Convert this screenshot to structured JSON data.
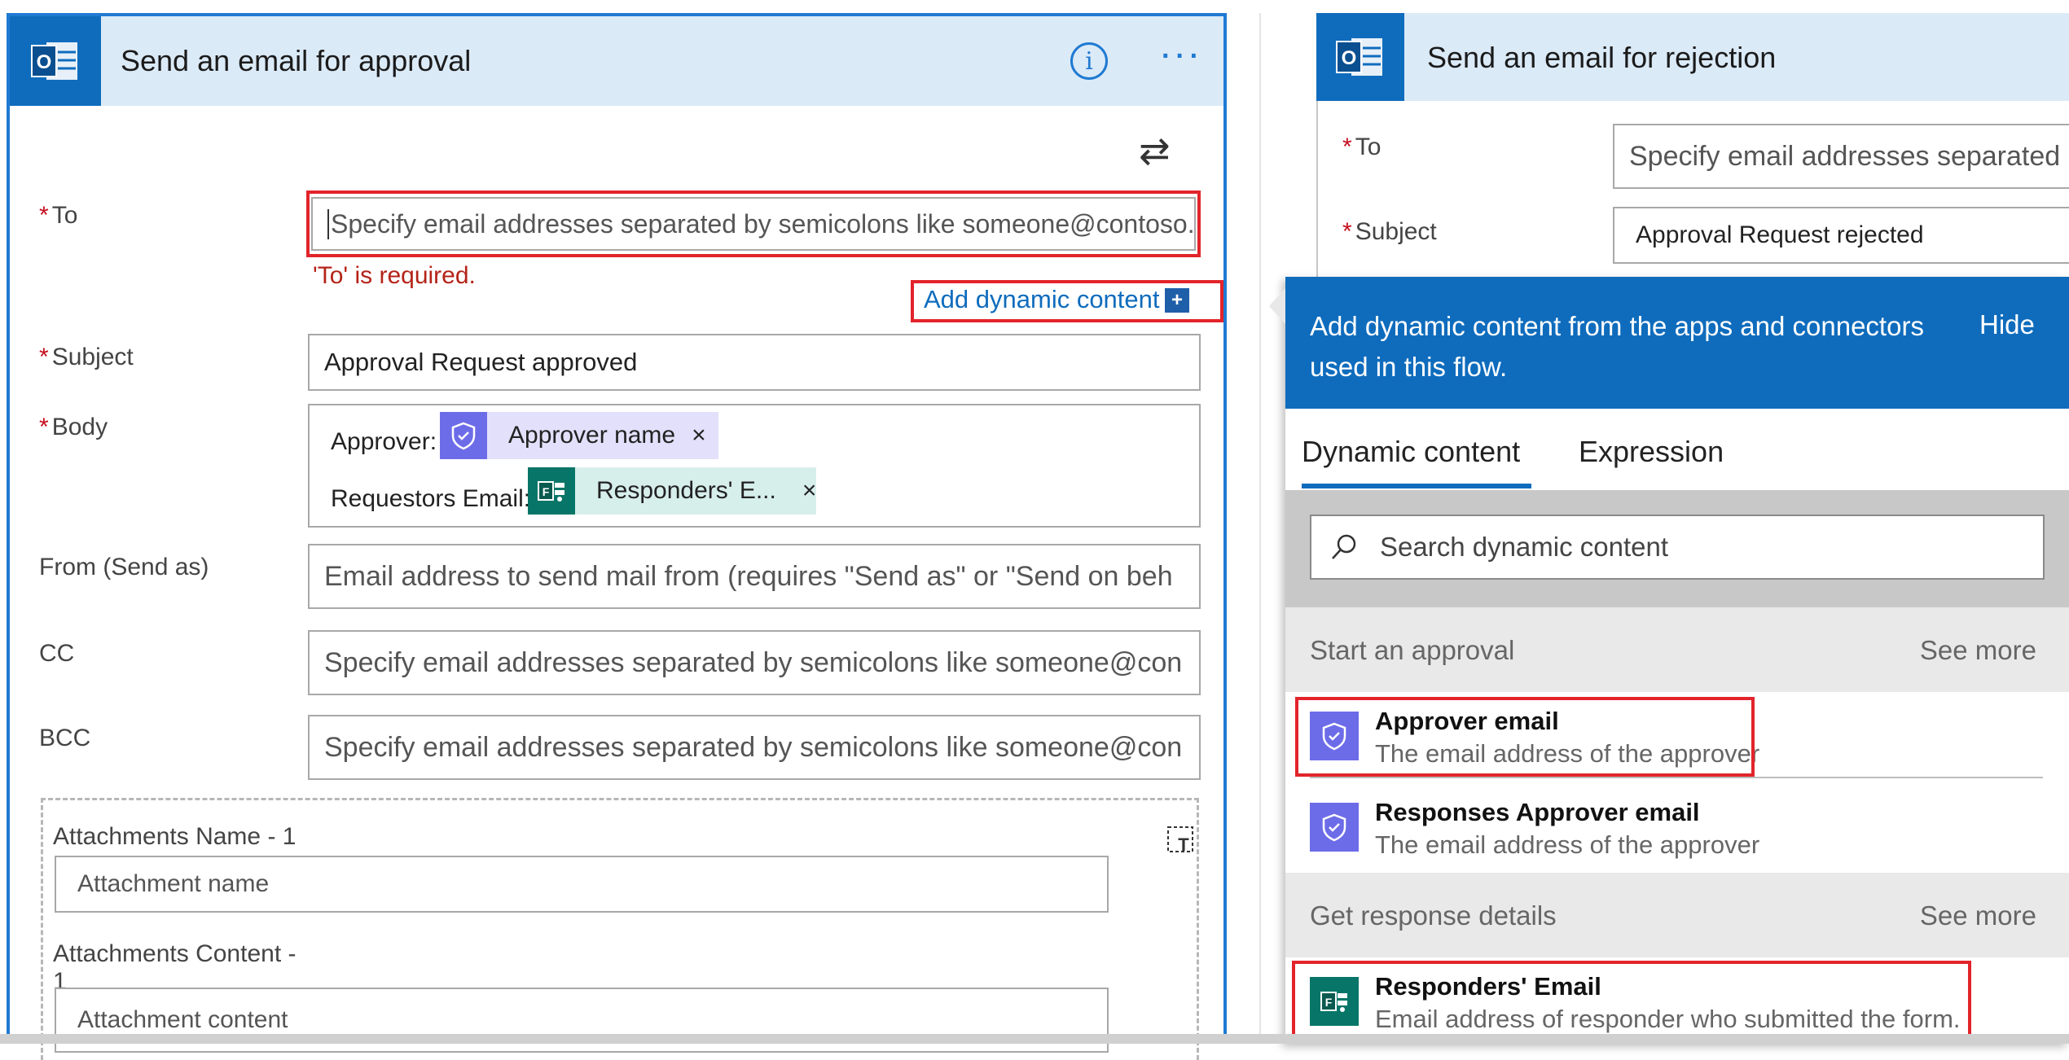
{
  "left_card": {
    "title": "Send an email for approval",
    "to_label": "To",
    "to_placeholder": "Specify email addresses separated by semicolons like someone@contoso.com",
    "to_error": "'To' is required.",
    "add_dynamic_label": "Add dynamic content",
    "add_dynamic_plus": "+",
    "subject_label": "Subject",
    "subject_value": "Approval Request approved",
    "body_label": "Body",
    "body_line1_label": "Approver:",
    "body_token1": "Approver name",
    "body_line2_label": "Requestors Email:",
    "body_token2": "Responders' E...",
    "token_close": "×",
    "from_label": "From (Send as)",
    "from_placeholder": "Email address to send mail from (requires \"Send as\" or \"Send on beh",
    "cc_label": "CC",
    "cc_placeholder": "Specify email addresses separated by semicolons like someone@con",
    "bcc_label": "BCC",
    "bcc_placeholder": "Specify email addresses separated by semicolons like someone@con",
    "attach_name_label": "Attachments Name - 1",
    "attach_name_placeholder": "Attachment name",
    "attach_content_label": "Attachments Content -",
    "attach_content_label_2": "1",
    "attach_content_placeholder": "Attachment content",
    "info_glyph": "i",
    "more_glyph": "···",
    "swap_glyph": "⇄"
  },
  "right_card": {
    "title": "Send an email for rejection",
    "to_label": "To",
    "to_placeholder": "Specify email addresses separated b",
    "subject_label": "Subject",
    "subject_value": "Approval Request rejected"
  },
  "dynamic_panel": {
    "header": "Add dynamic content from the apps and connectors used in this flow.",
    "hide": "Hide",
    "tabs": [
      "Dynamic content",
      "Expression"
    ],
    "search_placeholder": "Search dynamic content",
    "sections": [
      {
        "title": "Start an approval",
        "see_more": "See more",
        "items": [
          {
            "title": "Approver email",
            "desc": "The email address of the approver",
            "icon": "approval-icon"
          },
          {
            "title": "Responses Approver email",
            "desc": "The email address of the approver",
            "icon": "approval-icon"
          }
        ]
      },
      {
        "title": "Get response details",
        "see_more": "See more",
        "items": [
          {
            "title": "Responders' Email",
            "desc": "Email address of responder who submitted the form.",
            "icon": "forms-icon"
          }
        ]
      }
    ]
  },
  "colors": {
    "accent": "#0f6cbd",
    "header_bg": "#dbeaf7",
    "highlight_red": "#e2242b",
    "approval_purple": "#6d6ce8",
    "forms_teal": "#077568",
    "token_purple_bg": "#e3e0fb",
    "token_teal_bg": "#d7efeb"
  }
}
